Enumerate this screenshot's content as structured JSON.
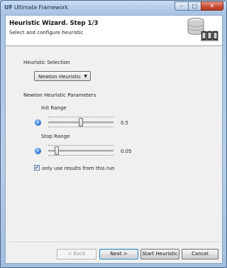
{
  "window": {
    "title": "Ultimate Framework",
    "app_icon": "UF",
    "controls": {
      "minimize": "–",
      "maximize": "□",
      "close": "✕"
    }
  },
  "wizard": {
    "title": "Heuristic Wizard. Step 1/3",
    "subtitle": "Select and configure heuristic",
    "icon": "database-hardware-icon"
  },
  "heuristic_selection": {
    "label": "Heuristic Selection",
    "selected": "Newton Heuristic"
  },
  "parameters": {
    "label": "Newton Heuristic Parameters",
    "init_range": {
      "label": "Init Range",
      "value_text": "0.5",
      "level": 0.5
    },
    "stop_range": {
      "label": "Stop Range",
      "value_text": "0.05",
      "level": 0.1
    }
  },
  "only_use_results": {
    "label": "only use results from this run",
    "checked": true
  },
  "buttons": {
    "back": "< Back",
    "next": "Next >",
    "start": "Start Heuristic",
    "cancel": "Cancel"
  }
}
